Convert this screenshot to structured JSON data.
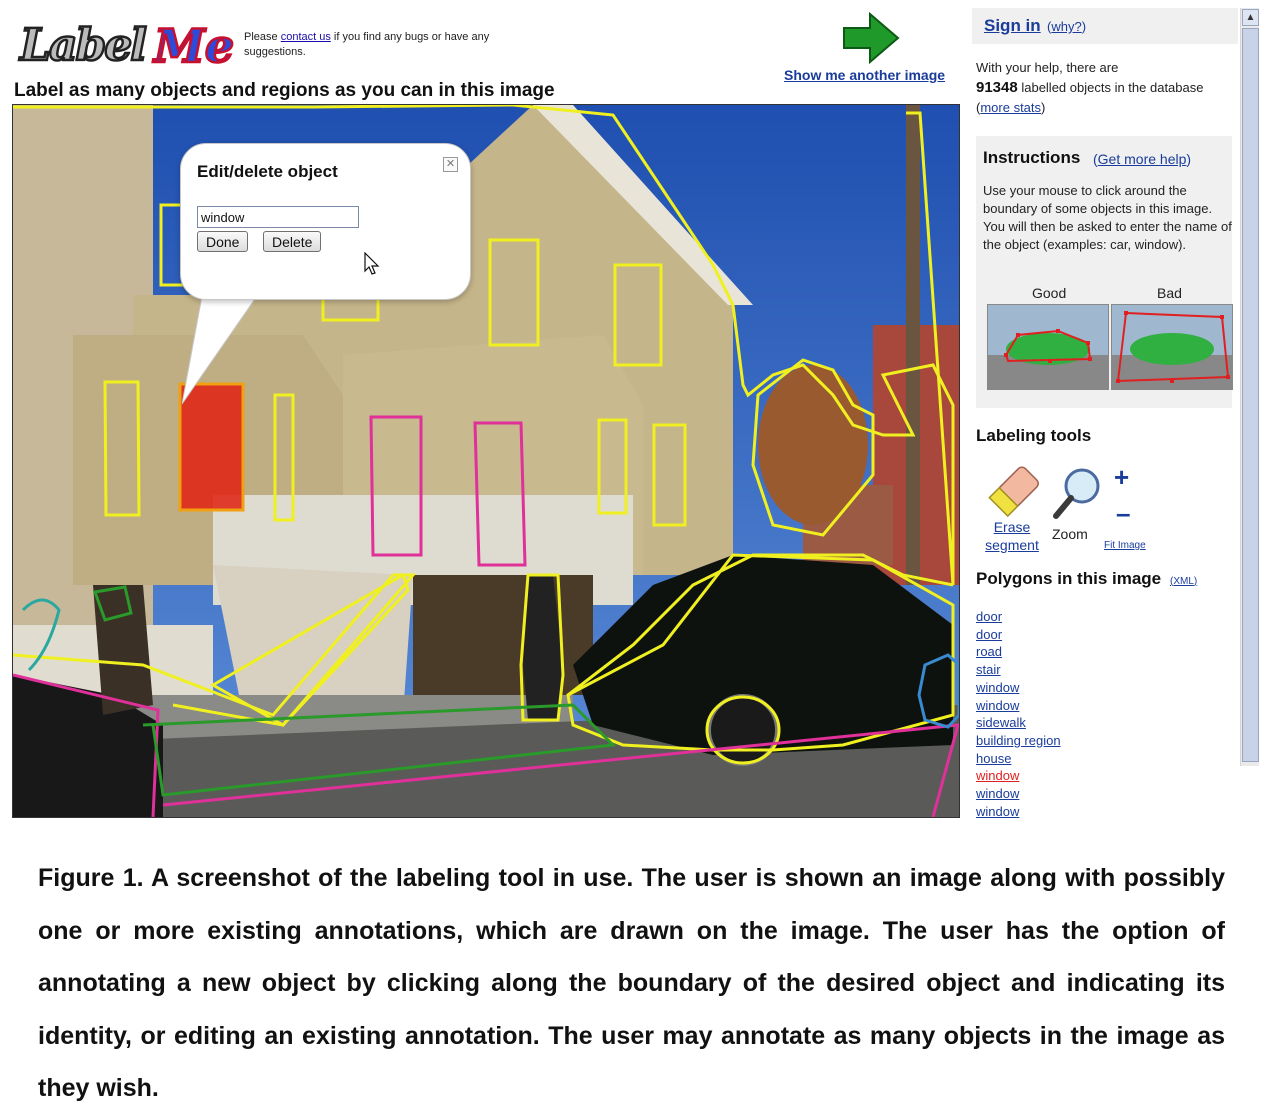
{
  "header": {
    "logo_text": "LabelMe",
    "notice_pre": "Please ",
    "contact_link": "contact us",
    "notice_post": " if you find any bugs or have any suggestions.",
    "heading": "Label as many objects and regions as you can in this image",
    "show_another": "Show me another image"
  },
  "popup": {
    "title": "Edit/delete object",
    "close_glyph": "✕",
    "input_value": "window",
    "done_label": "Done",
    "delete_label": "Delete"
  },
  "panel": {
    "sign_in": "Sign in",
    "why": "why?",
    "stats_pre": "With your help, there are",
    "stats_count": "91348",
    "stats_post": "labelled objects in the database",
    "more_stats": "more stats",
    "instructions_title": "Instructions",
    "get_more_help": "Get more help",
    "instructions_text": "Use your mouse to click around the boundary of some objects in this image. You will then be asked to enter the name of the object (examples: car, window).",
    "good_label": "Good",
    "bad_label": "Bad",
    "labeling_tools": "Labeling tools",
    "erase_segment": "Erase segment",
    "zoom": "Zoom",
    "zoom_plus": "+",
    "zoom_minus": "–",
    "fit_image": "Fit Image",
    "polygons_title": "Polygons in this image",
    "xml": "XML",
    "polygons": [
      {
        "label": "door",
        "selected": false
      },
      {
        "label": "door",
        "selected": false
      },
      {
        "label": "road",
        "selected": false
      },
      {
        "label": "stair",
        "selected": false
      },
      {
        "label": "window",
        "selected": false
      },
      {
        "label": "window",
        "selected": false
      },
      {
        "label": "sidewalk",
        "selected": false
      },
      {
        "label": "building region",
        "selected": false
      },
      {
        "label": "house",
        "selected": false
      },
      {
        "label": "window",
        "selected": true
      },
      {
        "label": "window",
        "selected": false
      },
      {
        "label": "window",
        "selected": false
      }
    ]
  },
  "caption": "Figure 1. A screenshot of the labeling tool in use. The user is shown an image along with possibly one or more existing annotations, which are drawn on the image. The user has the option of annotating a new object by clicking along the boundary of the desired object and indicating its identity, or editing an existing annotation. The user may annotate as many objects in the image as they wish.",
  "colors": {
    "annotation_yellow": "#f0f020",
    "annotation_pink": "#e0309a",
    "annotation_green": "#2a9a2a",
    "annotation_blue": "#3a8ad0",
    "selected_fill": "#e02010",
    "link_blue": "#1a3c9a",
    "panel_gray": "#f0f0f0"
  },
  "icons": [
    "next-arrow-icon",
    "close-icon",
    "mouse-cursor-icon",
    "eraser-icon",
    "magnifier-icon",
    "scroll-up-icon"
  ]
}
